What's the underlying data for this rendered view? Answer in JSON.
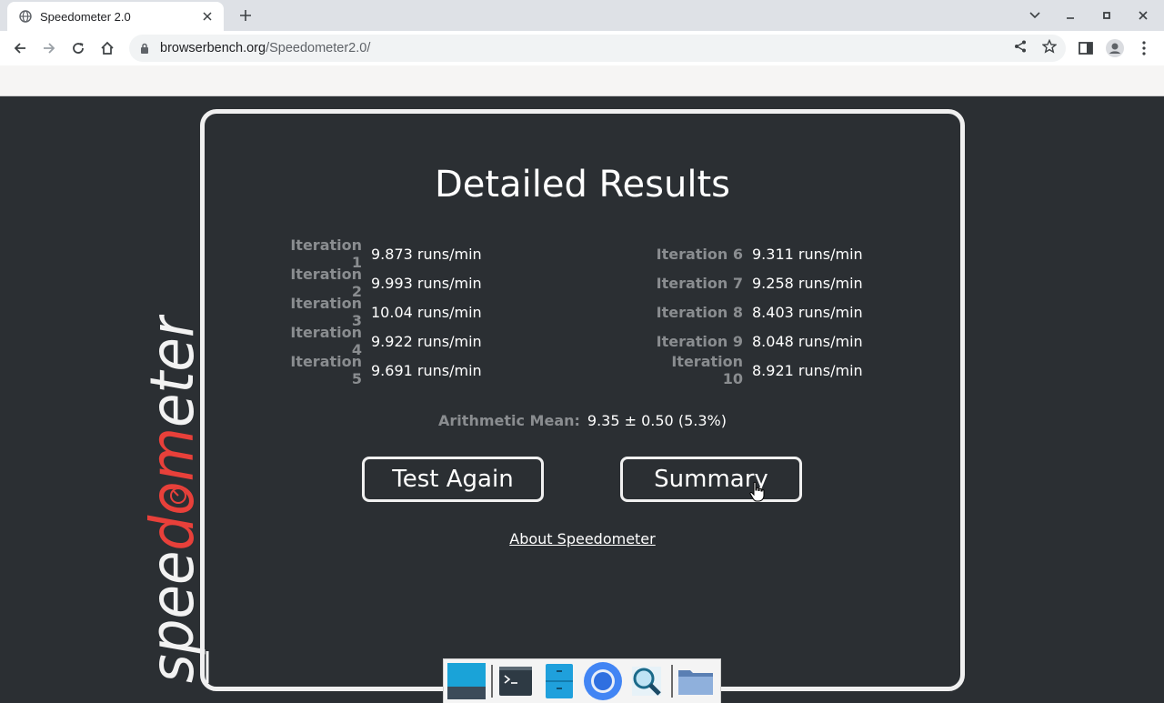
{
  "browser": {
    "tab_title": "Speedometer 2.0",
    "url_domain": "browserbench.org",
    "url_path": "/Speedometer2.0/"
  },
  "logo": {
    "prefix": "spee",
    "highlight": "dom",
    "suffix": "eter",
    "highlight_color": "#e8403a"
  },
  "results": {
    "title": "Detailed Results",
    "left_column": [
      {
        "label": "Iteration 1",
        "value": "9.873 runs/min"
      },
      {
        "label": "Iteration 2",
        "value": "9.993 runs/min"
      },
      {
        "label": "Iteration 3",
        "value": "10.04 runs/min"
      },
      {
        "label": "Iteration 4",
        "value": "9.922 runs/min"
      },
      {
        "label": "Iteration 5",
        "value": "9.691 runs/min"
      }
    ],
    "right_column": [
      {
        "label": "Iteration 6",
        "value": "9.311 runs/min"
      },
      {
        "label": "Iteration 7",
        "value": "9.258 runs/min"
      },
      {
        "label": "Iteration 8",
        "value": "8.403 runs/min"
      },
      {
        "label": "Iteration 9",
        "value": "8.048 runs/min"
      },
      {
        "label": "Iteration 10",
        "value": "8.921 runs/min"
      }
    ],
    "mean_label": "Arithmetic Mean:",
    "mean_value": "9.35 ± 0.50 (5.3%)",
    "test_again_label": "Test Again",
    "summary_label": "Summary",
    "about_label": "About Speedometer"
  },
  "colors": {
    "page_background": "#2b2f33",
    "label_gray": "#8a8d90"
  }
}
